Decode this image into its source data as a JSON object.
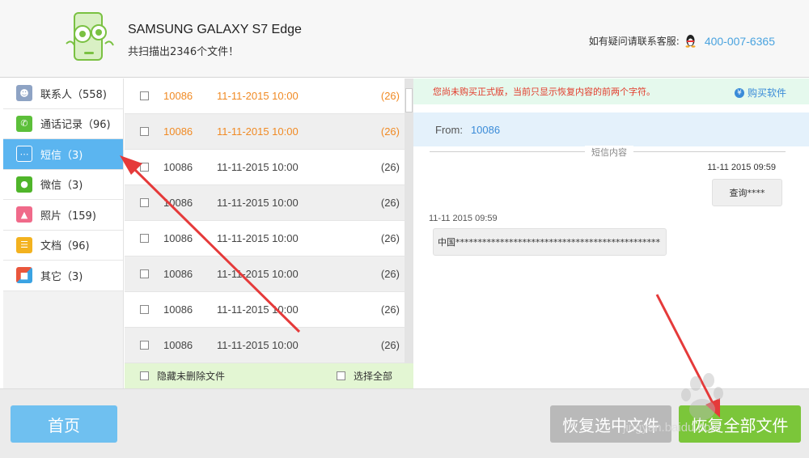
{
  "header": {
    "device_name": "SAMSUNG  GALAXY S7 Edge",
    "scan_summary": "共扫描出2346个文件！",
    "support_label": "如有疑问请联系客服:",
    "support_phone": "400-007-6365"
  },
  "sidebar": {
    "items": [
      {
        "label": "联系人（558)",
        "icon": "contacts-icon",
        "color": "#8ea3c4"
      },
      {
        "label": "通话记录（96)",
        "icon": "phone-icon",
        "color": "#5cbf3a"
      },
      {
        "label": "短信（3)",
        "icon": "sms-icon",
        "color": "#4da8e8"
      },
      {
        "label": "微信（3)",
        "icon": "wechat-icon",
        "color": "#4fb52a"
      },
      {
        "label": "照片（159)",
        "icon": "photo-icon",
        "color": "#f06a8a"
      },
      {
        "label": "文档（96)",
        "icon": "document-icon",
        "color": "#f3b21f"
      },
      {
        "label": "其它（3)",
        "icon": "other-icon",
        "color": "#e9563c"
      }
    ],
    "active_index": 2
  },
  "messages": {
    "rows": [
      {
        "number": "10086",
        "datetime": "11-11-2015  10:00",
        "count": "(26)"
      },
      {
        "number": "10086",
        "datetime": "11-11-2015  10:00",
        "count": "(26)"
      },
      {
        "number": "10086",
        "datetime": "11-11-2015  10:00",
        "count": "(26)"
      },
      {
        "number": "10086",
        "datetime": "11-11-2015  10:00",
        "count": "(26)"
      },
      {
        "number": "10086",
        "datetime": "11-11-2015  10:00",
        "count": "(26)"
      },
      {
        "number": "10086",
        "datetime": "11-11-2015  10:00",
        "count": "(26)"
      },
      {
        "number": "10086",
        "datetime": "11-11-2015  10:00",
        "count": "(26)"
      },
      {
        "number": "10086",
        "datetime": "11-11-2015  10:00",
        "count": "(26)"
      }
    ],
    "hide_undeleted_label": "隐藏未删除文件",
    "select_all_label": "选择全部"
  },
  "preview": {
    "notice": "您尚未购买正式版，当前只显示恢复内容的前两个字符。",
    "buy_label": "购买软件",
    "from_label": "From:",
    "from_value": "10086",
    "content_heading": "短信内容",
    "sent_time": "11-11  2015  09:59",
    "sent_text": "查询****",
    "received_time": "11-11  2015  09:59",
    "received_text": "中国**********************************************"
  },
  "bottom": {
    "home_label": "首页",
    "recover_selected_label": "恢复选中文件",
    "recover_all_label": "恢复全部文件"
  },
  "watermark": {
    "text": "jingyan.baidu.com"
  }
}
